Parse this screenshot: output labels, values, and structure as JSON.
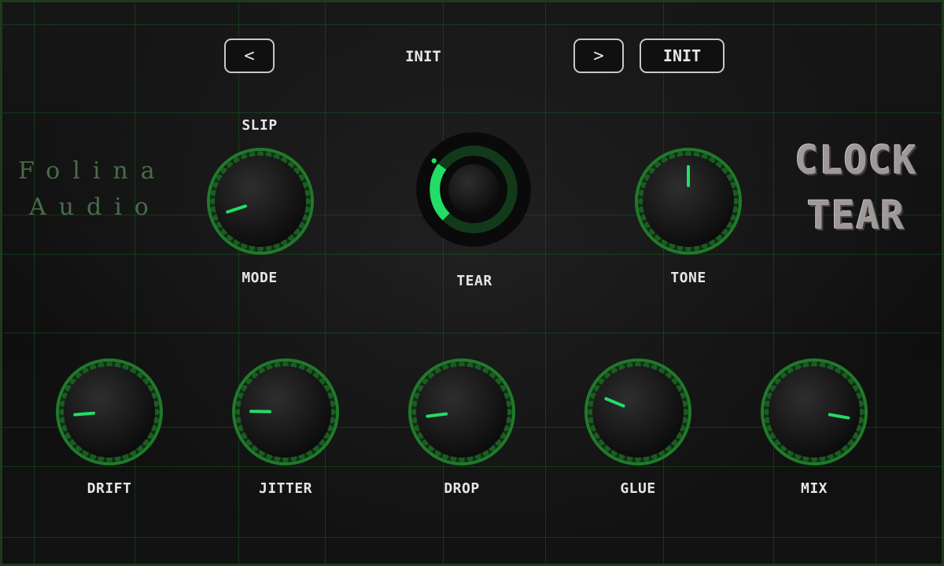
{
  "header": {
    "prev_label": "<",
    "next_label": ">",
    "preset_name": "INIT",
    "init_button_label": "INIT"
  },
  "brand": {
    "line1": "Folina",
    "line2": "Audio"
  },
  "product": {
    "line1": "CLOCK",
    "line2": "TEAR"
  },
  "mode_selector": {
    "top_label": "SLIP",
    "bottom_label": "MODE"
  },
  "colors": {
    "accent": "#22dd66",
    "ring": "#1f7a2a",
    "knob_body": "#0a0a0a",
    "text": "#e6e6e6"
  },
  "knobs": {
    "mode": {
      "label": "MODE",
      "value": 0.1
    },
    "tear": {
      "label": "TEAR",
      "value": 0.3
    },
    "tone": {
      "label": "TONE",
      "value": 0.5
    },
    "drift": {
      "label": "DRIFT",
      "value": 0.15
    },
    "jitter": {
      "label": "JITTER",
      "value": 0.17
    },
    "drop": {
      "label": "DROP",
      "value": 0.14
    },
    "glue": {
      "label": "GLUE",
      "value": 0.25
    },
    "mix": {
      "label": "MIX",
      "value": 0.87
    }
  }
}
